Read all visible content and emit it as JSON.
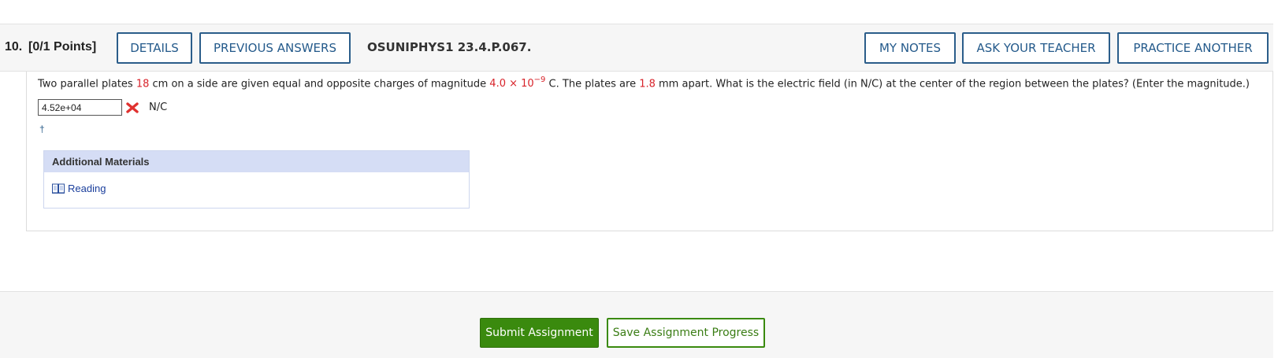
{
  "question": {
    "number": "10.",
    "points": "[0/1 Points]",
    "details_label": "DETAILS",
    "previous_answers_label": "PREVIOUS ANSWERS",
    "reference": "OSUNIPHYS1 23.4.P.067.",
    "my_notes_label": "MY NOTES",
    "ask_teacher_label": "ASK YOUR TEACHER",
    "practice_another_label": "PRACTICE ANOTHER"
  },
  "problem": {
    "text_1": "Two parallel plates ",
    "side_value": "18",
    "text_2": " cm on a side are given equal and opposite charges of magnitude ",
    "charge_mantissa": "4.0 × 10",
    "charge_exponent": "−9",
    "text_3": " C. The plates are ",
    "separation_value": "1.8",
    "text_4": " mm apart. What is the electric field (in N/C) at the center of the region between the plates? (Enter the magnitude.)"
  },
  "answer": {
    "value": "4.52e+04",
    "status": "incorrect",
    "unit": "N/C"
  },
  "dagger": "†",
  "additional_materials": {
    "title": "Additional Materials",
    "reading_label": "Reading"
  },
  "footer": {
    "submit_label": "Submit Assignment",
    "save_label": "Save Assignment Progress"
  },
  "colors": {
    "accent_blue": "#2b5d8a",
    "highlight_red": "#d8232a",
    "submit_green": "#3a8a0e",
    "materials_header": "#d5ddf5"
  }
}
